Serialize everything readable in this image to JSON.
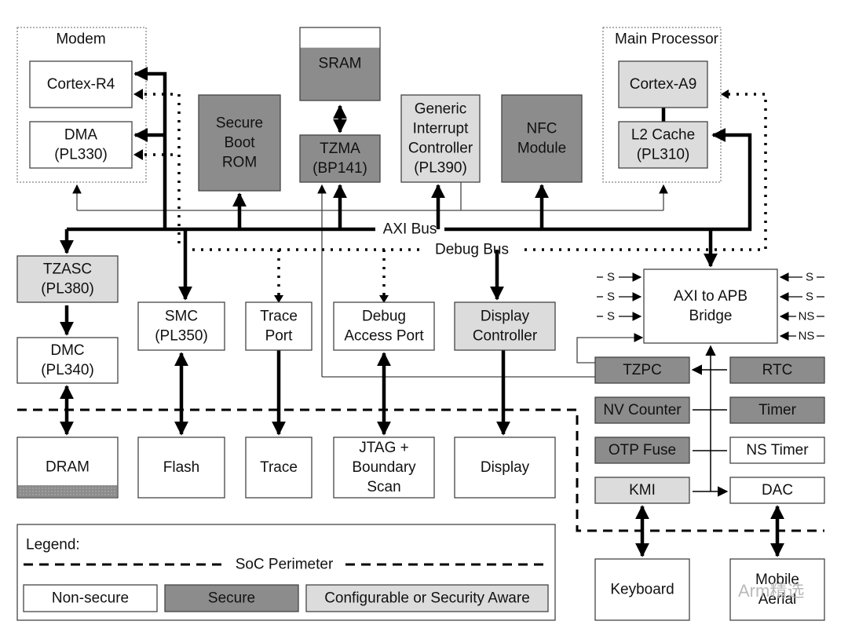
{
  "colors": {
    "non_secure": "#ffffff",
    "secure": "#8c8c8c",
    "configurable": "#dcdcdc"
  },
  "groups": {
    "modem": "Modem",
    "main_processor": "Main Processor"
  },
  "buses": {
    "axi": "AXI Bus",
    "debug": "Debug Bus"
  },
  "blocks": {
    "cortex_r4": [
      "Cortex-R4"
    ],
    "dma": [
      "DMA",
      "(PL330)"
    ],
    "secure_boot_rom": [
      "Secure",
      "Boot",
      "ROM"
    ],
    "sram": [
      "SRAM"
    ],
    "tzma": [
      "TZMA",
      "(BP141)"
    ],
    "gic": [
      "Generic",
      "Interrupt",
      "Controller",
      "(PL390)"
    ],
    "nfc": [
      "NFC",
      "Module"
    ],
    "cortex_a9": [
      "Cortex-A9"
    ],
    "l2_cache": [
      "L2 Cache",
      "(PL310)"
    ],
    "tzasc": [
      "TZASC",
      "(PL380)"
    ],
    "dmc": [
      "DMC",
      "(PL340)"
    ],
    "smc": [
      "SMC",
      "(PL350)"
    ],
    "trace_port": [
      "Trace",
      "Port"
    ],
    "debug_access_port": [
      "Debug",
      "Access Port"
    ],
    "display_controller": [
      "Display",
      "Controller"
    ],
    "axi_apb_bridge": [
      "AXI to APB",
      "Bridge"
    ],
    "tzpc": [
      "TZPC"
    ],
    "rtc": [
      "RTC"
    ],
    "nv_counter": [
      "NV Counter"
    ],
    "timer": [
      "Timer"
    ],
    "otp_fuse": [
      "OTP Fuse"
    ],
    "ns_timer": [
      "NS Timer"
    ],
    "kmi": [
      "KMI"
    ],
    "dac": [
      "DAC"
    ],
    "dram": [
      "DRAM"
    ],
    "flash": [
      "Flash"
    ],
    "trace": [
      "Trace"
    ],
    "jtag": [
      "JTAG +",
      "Boundary",
      "Scan"
    ],
    "display": [
      "Display"
    ],
    "keyboard": [
      "Keyboard"
    ],
    "mobile_aerial": [
      "Mobile",
      "Aerial"
    ]
  },
  "bridge_inputs": {
    "left": [
      "S",
      "S",
      "S"
    ],
    "right": [
      "S",
      "S",
      "NS",
      "NS"
    ]
  },
  "legend": {
    "title": "Legend:",
    "perimeter": "SoC Perimeter",
    "non_secure": "Non-secure",
    "secure": "Secure",
    "configurable": "Configurable or Security Aware"
  },
  "watermark": "Arm精选"
}
